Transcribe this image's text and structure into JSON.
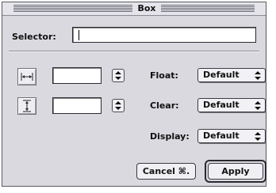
{
  "window": {
    "title": "Box"
  },
  "selector": {
    "label": "Selector:",
    "value": ""
  },
  "width_row": {
    "icon": "horizontal-width-icon",
    "value": ""
  },
  "height_row": {
    "icon": "vertical-height-icon",
    "value": ""
  },
  "float": {
    "label": "Float:",
    "value": "Default"
  },
  "clear": {
    "label": "Clear:",
    "value": "Default"
  },
  "display": {
    "label": "Display:",
    "value": "Default"
  },
  "buttons": {
    "cancel": "Cancel ⌘.",
    "apply": "Apply"
  }
}
